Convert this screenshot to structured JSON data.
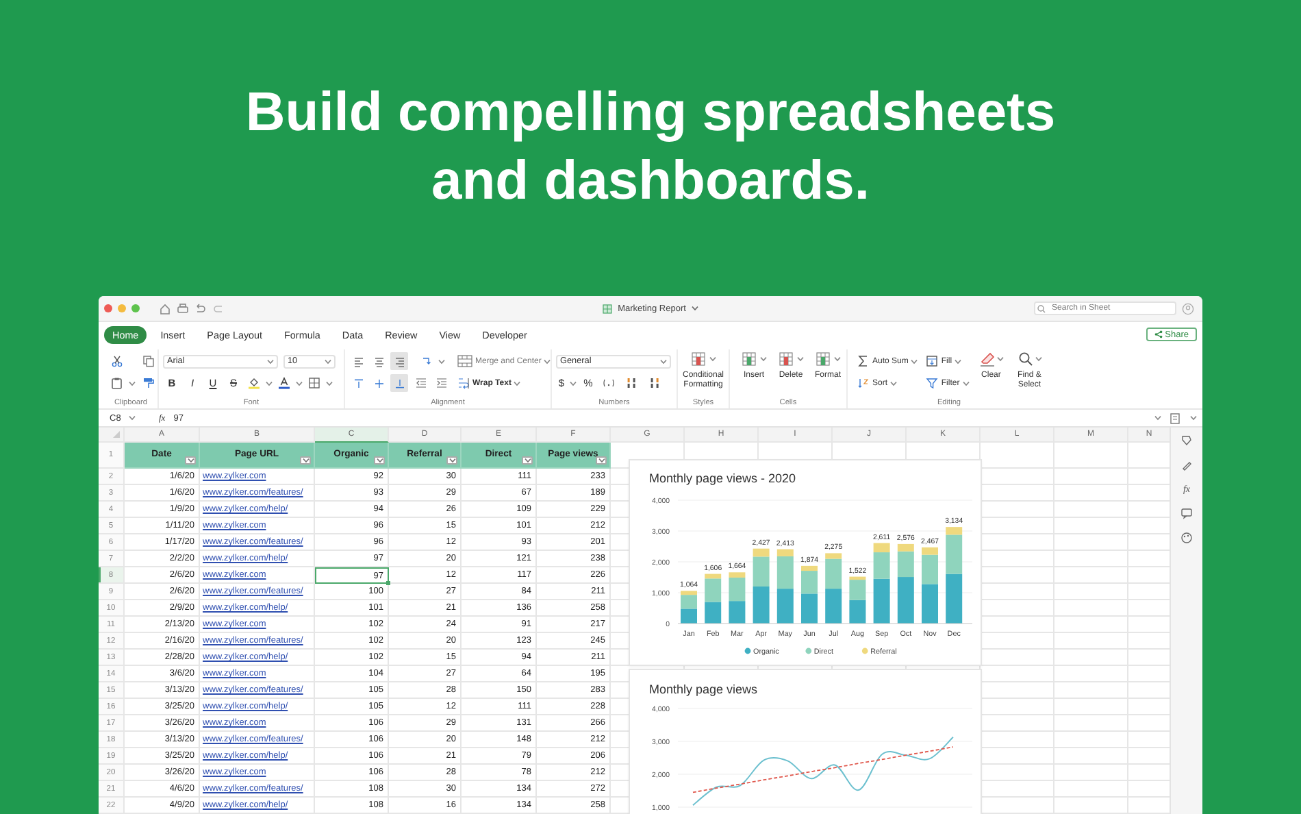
{
  "headline": "Build compelling spreadsheets and dashboards.",
  "window": {
    "title": "Marketing Report",
    "search_placeholder": "Search in Sheet",
    "share_button": "Share"
  },
  "tabs": [
    {
      "label": "Home",
      "selected": true
    },
    {
      "label": "Insert",
      "selected": false
    },
    {
      "label": "Page Layout",
      "selected": false
    },
    {
      "label": "Formula",
      "selected": false
    },
    {
      "label": "Data",
      "selected": false
    },
    {
      "label": "Review",
      "selected": false
    },
    {
      "label": "View",
      "selected": false
    },
    {
      "label": "Developer",
      "selected": false
    }
  ],
  "ribbon": {
    "font_name": "Arial",
    "font_size": "10",
    "format_buttons": [
      "B",
      "I",
      "U",
      "S"
    ],
    "horizontal_align": [
      {
        "kind": "left",
        "selected": false
      },
      {
        "kind": "center",
        "selected": false
      },
      {
        "kind": "right",
        "selected": true
      }
    ],
    "vertical_align": [
      {
        "kind": "top",
        "selected": false
      },
      {
        "kind": "middle",
        "selected": false
      },
      {
        "kind": "bottom",
        "selected": true
      }
    ],
    "merge_button": "Merge and Center",
    "wrap_button": "Wrap Text",
    "number_format": "General",
    "number_symbols": [
      "$",
      "%"
    ],
    "conditional_button": "Conditional Formatting",
    "cell_buttons": [
      {
        "kind": "insert",
        "label": "Insert"
      },
      {
        "kind": "delete",
        "label": "Delete"
      },
      {
        "kind": "format",
        "label": "Format"
      }
    ],
    "editing_buttons": [
      {
        "kind": "autosum",
        "label": "Auto Sum"
      },
      {
        "kind": "fill",
        "label": "Fill"
      },
      {
        "kind": "sort",
        "label": "Sort"
      },
      {
        "kind": "filter",
        "label": "Filter"
      },
      {
        "kind": "clear",
        "label": "Clear"
      },
      {
        "kind": "find",
        "label": "Find & Select"
      }
    ],
    "group_labels": [
      "Clipboard",
      "Font",
      "Alignment",
      "Numbers",
      "Styles",
      "Cells",
      "Editing"
    ]
  },
  "formula_bar": {
    "cell_ref": "C8",
    "fx": "fx",
    "value": "97"
  },
  "sidebar": {
    "function_label": "fx"
  },
  "table": {
    "columns": [
      {
        "label": "A",
        "selected": false
      },
      {
        "label": "B",
        "selected": false
      },
      {
        "label": "C",
        "selected": true
      },
      {
        "label": "D",
        "selected": false
      },
      {
        "label": "E",
        "selected": false
      },
      {
        "label": "F",
        "selected": false
      },
      {
        "label": "G",
        "selected": false
      },
      {
        "label": "H",
        "selected": false
      },
      {
        "label": "I",
        "selected": false
      },
      {
        "label": "J",
        "selected": false
      },
      {
        "label": "K",
        "selected": false
      },
      {
        "label": "L",
        "selected": false
      },
      {
        "label": "M",
        "selected": false
      },
      {
        "label": "N",
        "selected": false
      }
    ],
    "header_row": {
      "number": "1",
      "headers": [
        "Date",
        "Page URL",
        "Organic",
        "Referral",
        "Direct",
        "Page views"
      ]
    },
    "rows": [
      {
        "number": "2",
        "selected": false,
        "cells": [
          "1/6/20",
          "www.zylker.com",
          "92",
          "30",
          "111",
          "233"
        ]
      },
      {
        "number": "3",
        "selected": false,
        "cells": [
          "1/6/20",
          "www.zylker.com/features/",
          "93",
          "29",
          "67",
          "189"
        ]
      },
      {
        "number": "4",
        "selected": false,
        "cells": [
          "1/9/20",
          "www.zylker.com/help/",
          "94",
          "26",
          "109",
          "229"
        ]
      },
      {
        "number": "5",
        "selected": false,
        "cells": [
          "1/11/20",
          "www.zylker.com",
          "96",
          "15",
          "101",
          "212"
        ]
      },
      {
        "number": "6",
        "selected": false,
        "cells": [
          "1/17/20",
          "www.zylker.com/features/",
          "96",
          "12",
          "93",
          "201"
        ]
      },
      {
        "number": "7",
        "selected": false,
        "cells": [
          "2/2/20",
          "www.zylker.com/help/",
          "97",
          "20",
          "121",
          "238"
        ]
      },
      {
        "number": "8",
        "selected": true,
        "cells": [
          "2/6/20",
          "www.zylker.com",
          "97",
          "12",
          "117",
          "226"
        ]
      },
      {
        "number": "9",
        "selected": false,
        "cells": [
          "2/6/20",
          "www.zylker.com/features/",
          "100",
          "27",
          "84",
          "211"
        ]
      },
      {
        "number": "10",
        "selected": false,
        "cells": [
          "2/9/20",
          "www.zylker.com/help/",
          "101",
          "21",
          "136",
          "258"
        ]
      },
      {
        "number": "11",
        "selected": false,
        "cells": [
          "2/13/20",
          "www.zylker.com",
          "102",
          "24",
          "91",
          "217"
        ]
      },
      {
        "number": "12",
        "selected": false,
        "cells": [
          "2/16/20",
          "www.zylker.com/features/",
          "102",
          "20",
          "123",
          "245"
        ]
      },
      {
        "number": "13",
        "selected": false,
        "cells": [
          "2/28/20",
          "www.zylker.com/help/",
          "102",
          "15",
          "94",
          "211"
        ]
      },
      {
        "number": "14",
        "selected": false,
        "cells": [
          "3/6/20",
          "www.zylker.com",
          "104",
          "27",
          "64",
          "195"
        ]
      },
      {
        "number": "15",
        "selected": false,
        "cells": [
          "3/13/20",
          "www.zylker.com/features/",
          "105",
          "28",
          "150",
          "283"
        ]
      },
      {
        "number": "16",
        "selected": false,
        "cells": [
          "3/25/20",
          "www.zylker.com/help/",
          "105",
          "12",
          "111",
          "228"
        ]
      },
      {
        "number": "17",
        "selected": false,
        "cells": [
          "3/26/20",
          "www.zylker.com",
          "106",
          "29",
          "131",
          "266"
        ]
      },
      {
        "number": "18",
        "selected": false,
        "cells": [
          "3/13/20",
          "www.zylker.com/features/",
          "106",
          "20",
          "148",
          "212"
        ]
      },
      {
        "number": "19",
        "selected": false,
        "cells": [
          "3/25/20",
          "www.zylker.com/help/",
          "106",
          "21",
          "79",
          "206"
        ]
      },
      {
        "number": "20",
        "selected": false,
        "cells": [
          "3/26/20",
          "www.zylker.com",
          "106",
          "28",
          "78",
          "212"
        ]
      },
      {
        "number": "21",
        "selected": false,
        "cells": [
          "4/6/20",
          "www.zylker.com/features/",
          "108",
          "30",
          "134",
          "272"
        ]
      },
      {
        "number": "22",
        "selected": false,
        "cells": [
          "4/9/20",
          "www.zylker.com/help/",
          "108",
          "16",
          "134",
          "258"
        ]
      }
    ]
  },
  "charts": [
    {
      "chart_data": {
        "type": "bar",
        "title": "Monthly page views - 2020",
        "stacked": true,
        "categories": [
          "Jan",
          "Feb",
          "Mar",
          "Apr",
          "May",
          "Jun",
          "Jul",
          "Aug",
          "Sep",
          "Oct",
          "Nov",
          "Dec"
        ],
        "ylim": [
          0,
          4000
        ],
        "yticks": [
          {
            "value": 0,
            "label": "0"
          },
          {
            "value": 1000,
            "label": "1,000"
          },
          {
            "value": 2000,
            "label": "2,000"
          },
          {
            "value": 3000,
            "label": "3,000"
          },
          {
            "value": 4000,
            "label": "4,000"
          }
        ],
        "series": [
          {
            "name": "Organic",
            "color": "#3fb0c3",
            "values": [
              480,
              700,
              730,
              1200,
              1130,
              970,
              1130,
              760,
              1450,
              1510,
              1280,
              1610
            ]
          },
          {
            "name": "Direct",
            "color": "#8fd4bd",
            "values": [
              450,
              760,
              760,
              970,
              1050,
              740,
              970,
              660,
              860,
              830,
              950,
              1270
            ]
          },
          {
            "name": "Referral",
            "color": "#efd97e",
            "values": [
              130,
              150,
              170,
              260,
              230,
              160,
              180,
              100,
              300,
              240,
              240,
              250
            ]
          }
        ],
        "grid": true,
        "legend": true,
        "value_labels": [
          "1,064",
          "1,606",
          "1,664",
          "2,427",
          "2,413",
          "1,874",
          "2,275",
          "1,522",
          "2,611",
          "2,576",
          "2,467",
          "3,134"
        ]
      }
    },
    {
      "chart_data": {
        "type": "line",
        "title": "Monthly page views",
        "ylim": [
          1000,
          4000
        ],
        "grid": true,
        "yticks": [
          {
            "value": 1000,
            "label": "1,000"
          },
          {
            "value": 2000,
            "label": "2,000"
          },
          {
            "value": 3000,
            "label": "3,000"
          },
          {
            "value": 4000,
            "label": "4,000"
          }
        ],
        "series": [
          {
            "color": "#6cc0cf",
            "line_style": "solid",
            "values": [
              1060,
              1610,
              1660,
              2430,
              2410,
              1870,
              2280,
              1520,
              2610,
              2580,
              2470,
              3130
            ]
          },
          {
            "color": "#e0574c",
            "line_style": "dashed",
            "values": [
              1450,
              1580,
              1700,
              1830,
              1950,
              2080,
              2200,
              2330,
              2450,
              2580,
              2700,
              2830
            ]
          }
        ]
      }
    }
  ]
}
